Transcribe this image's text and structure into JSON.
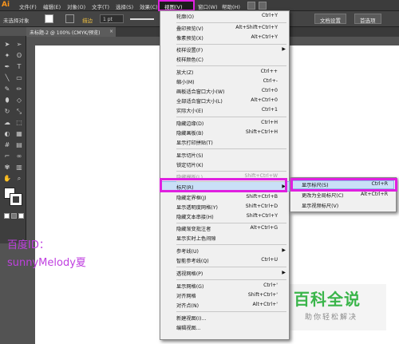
{
  "app": {
    "logo": "Ai"
  },
  "menubar": {
    "items": [
      "文件(F)",
      "编辑(E)",
      "对象(O)",
      "文字(T)",
      "选择(S)",
      "效果(C)",
      "视图(V)",
      "窗口(W)",
      "帮助(H)"
    ]
  },
  "control": {
    "selection_label": "未选择对象",
    "stroke_label": "描边",
    "stroke_weight": "1 pt",
    "doc_setup_button": "文档设置",
    "prefs_button": "首选项"
  },
  "tab": {
    "title": "未标题-2 @ 100% (CMYK/预览)",
    "close": "×"
  },
  "view_menu": {
    "items": [
      {
        "label": "轮廓(O)",
        "shortcut": "Ctrl+Y"
      },
      {
        "label": "叠印预览(V)",
        "shortcut": "Alt+Shift+Ctrl+Y"
      },
      {
        "label": "像素预览(X)",
        "shortcut": "Alt+Ctrl+Y"
      },
      {
        "label": "校样设置(F)",
        "shortcut": "",
        "submenu": true
      },
      {
        "label": "校样颜色(C)",
        "shortcut": ""
      },
      {
        "label": "放大(Z)",
        "shortcut": "Ctrl++"
      },
      {
        "label": "缩小(M)",
        "shortcut": "Ctrl+-"
      },
      {
        "label": "画板适合窗口大小(W)",
        "shortcut": "Ctrl+0"
      },
      {
        "label": "全部适合窗口大小(L)",
        "shortcut": "Alt+Ctrl+0"
      },
      {
        "label": "实际大小(E)",
        "shortcut": "Ctrl+1"
      },
      {
        "label": "隐藏边缘(D)",
        "shortcut": "Ctrl+H"
      },
      {
        "label": "隐藏画板(B)",
        "shortcut": "Shift+Ctrl+H"
      },
      {
        "label": "显示打印拼贴(T)",
        "shortcut": ""
      },
      {
        "label": "显示切片(S)",
        "shortcut": ""
      },
      {
        "label": "锁定切片(K)",
        "shortcut": ""
      },
      {
        "label": "隐藏模板(L)",
        "shortcut": "Shift+Ctrl+W",
        "disabled": true
      },
      {
        "label": "标尺(R)",
        "shortcut": "",
        "submenu": true
      },
      {
        "label": "隐藏定界框(J)",
        "shortcut": "Shift+Ctrl+B"
      },
      {
        "label": "显示透明度网格(Y)",
        "shortcut": "Shift+Ctrl+D"
      },
      {
        "label": "隐藏文本串接(H)",
        "shortcut": "Shift+Ctrl+Y"
      },
      {
        "label": "隐藏渐变批注者",
        "shortcut": "Alt+Ctrl+G"
      },
      {
        "label": "显示实时上色间隙",
        "shortcut": ""
      },
      {
        "label": "参考线(U)",
        "shortcut": "",
        "submenu": true
      },
      {
        "label": "智能参考线(Q)",
        "shortcut": "Ctrl+U"
      },
      {
        "label": "透视网格(P)",
        "shortcut": "",
        "submenu": true
      },
      {
        "label": "显示网格(G)",
        "shortcut": "Ctrl+'"
      },
      {
        "label": "对齐网格",
        "shortcut": "Shift+Ctrl+'"
      },
      {
        "label": "对齐点(N)",
        "shortcut": "Alt+Ctrl+'"
      },
      {
        "label": "新建视图(I)...",
        "shortcut": ""
      },
      {
        "label": "编辑视图...",
        "shortcut": ""
      }
    ]
  },
  "ruler_submenu": {
    "items": [
      {
        "label": "显示标尺(S)",
        "shortcut": "Ctrl+R"
      },
      {
        "label": "更改为全局标尺(C)",
        "shortcut": "Alt+Ctrl+R"
      },
      {
        "label": "显示视频标尺(V)",
        "shortcut": ""
      }
    ]
  },
  "watermark": {
    "line1": "百度ID：",
    "line2": "sunnyMelody夏",
    "brand": "百科全说",
    "slogan": "助你轻松解决"
  },
  "colors": {
    "highlight": "#e020e0",
    "brand_green": "#3ab54a"
  }
}
